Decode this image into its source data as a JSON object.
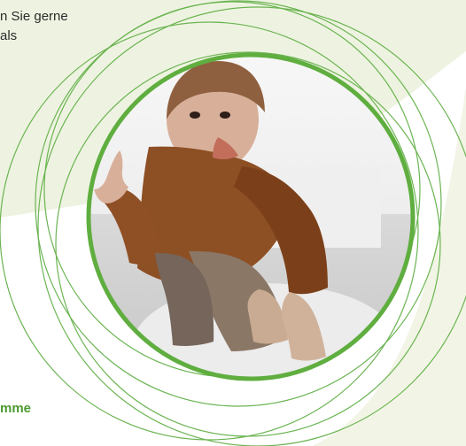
{
  "text": {
    "line1": "n Sie gerne",
    "line2": "als",
    "bottom_heading": "mme"
  },
  "colors": {
    "background": "#ffffff",
    "soft_green_shape": "#eef3e1",
    "ring_green": "#5fae3f",
    "thin_ring_green": "#64b14a",
    "heading_green": "#4b9a2f"
  },
  "image": {
    "description": "baby-crawling-photo"
  }
}
